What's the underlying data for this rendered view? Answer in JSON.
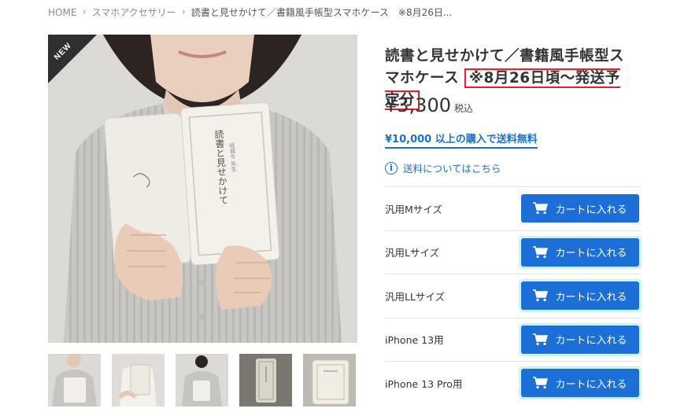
{
  "breadcrumb": {
    "home": "HOME",
    "category": "スマホアクセサリー",
    "current": "読書と見せかけて／書籍風手帳型スマホケース　※8月26日..."
  },
  "product": {
    "badge": "NEW",
    "title": "読書と見せかけて／書籍風手帳型スマホケース",
    "notice": "※8月26日頃〜発送予定分",
    "price": "¥3,300",
    "tax_label": "税込",
    "free_shipping": "¥10,000 以上の購入で送料無料",
    "shipping_info": "送料についてはこちら"
  },
  "variants": [
    {
      "name": "汎用Mサイズ",
      "button": "カートに入れる"
    },
    {
      "name": "汎用Lサイズ",
      "button": "カートに入れる"
    },
    {
      "name": "汎用LLサイズ",
      "button": "カートに入れる"
    },
    {
      "name": "iPhone 13用",
      "button": "カートに入れる"
    },
    {
      "name": "iPhone 13 Pro用",
      "button": "カートに入れる"
    }
  ],
  "colors": {
    "accent_blue": "#1b6fd6",
    "link_blue": "#1a73c9",
    "notice_red": "#e0232b",
    "badge_dark": "#2f2f2f"
  },
  "book_text": {
    "title": "読書と見せかけて",
    "author": "結城冬 先生"
  }
}
